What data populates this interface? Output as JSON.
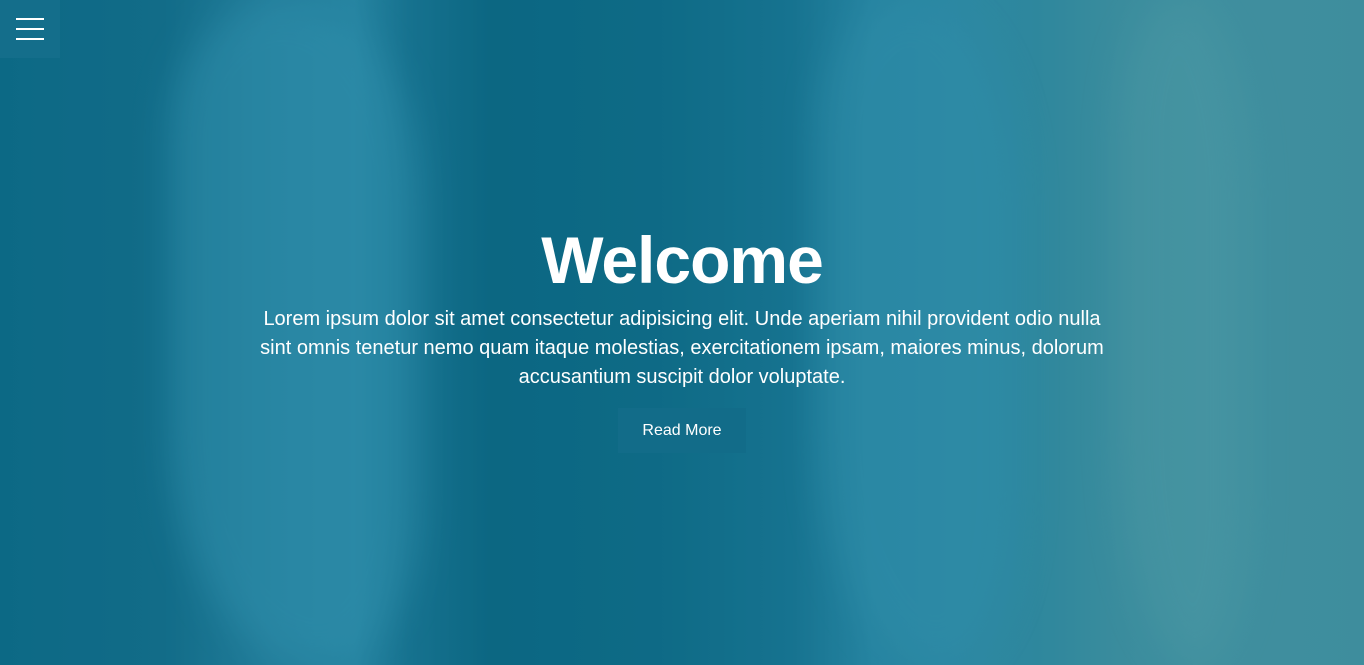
{
  "menu": {
    "icon": "hamburger-menu-icon"
  },
  "hero": {
    "title": "Welcome",
    "text": "Lorem ipsum dolor sit amet consectetur adipisicing elit. Unde aperiam nihil provident odio nulla sint omnis tenetur nemo quam itaque molestias, exercitationem ipsam, maiores minus, dolorum accusantium suscipit dolor voluptate.",
    "button_label": "Read More"
  },
  "colors": {
    "accent": "#126c89",
    "text": "#ffffff"
  }
}
